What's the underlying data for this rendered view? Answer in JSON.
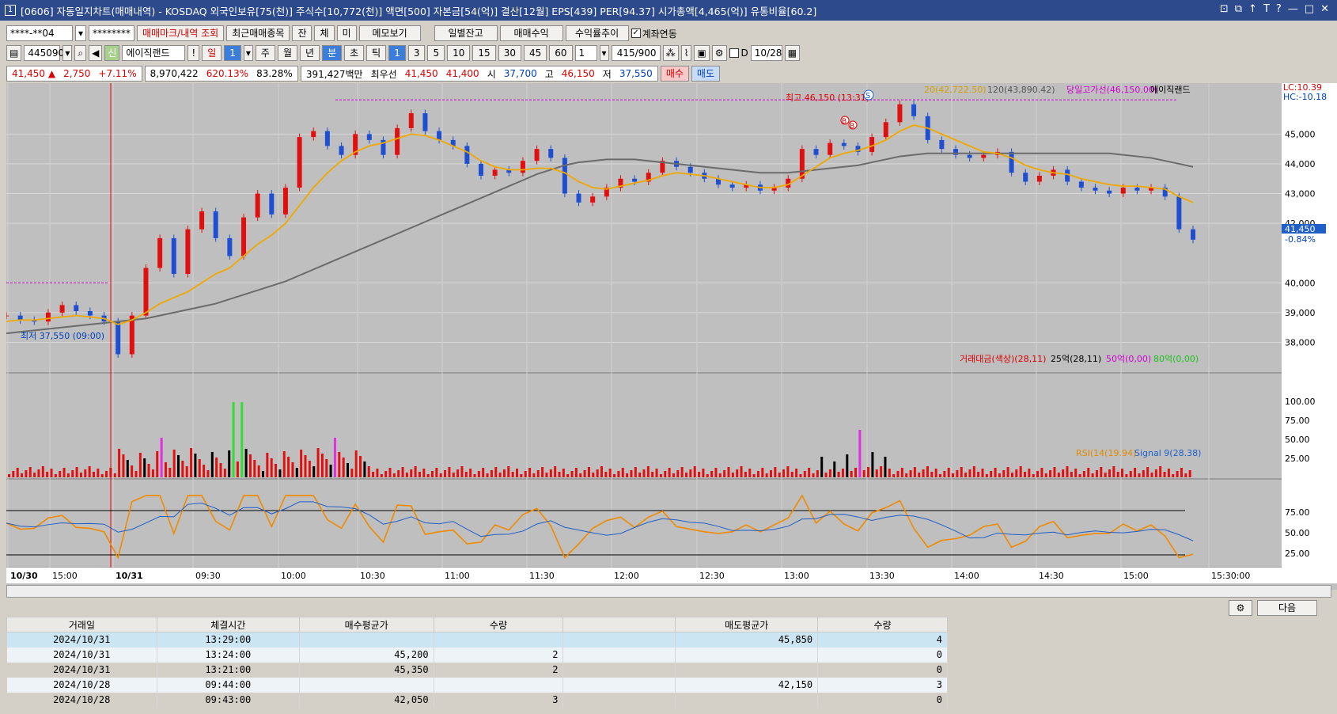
{
  "window": {
    "num": "1",
    "title": "[0606] 자동일지차트(매매내역) - KOSDAQ 외국인보유[75(천)] 주식수[10,772(천)] 액면[500] 자본금[54(억)] 결산[12월] EPS[439] PER[94.37] 시가총액[4,465(억)] 유통비율[60.2]",
    "controls": [
      "⊡",
      "⧉",
      "↑",
      "T",
      "?",
      "—",
      "□",
      "✕"
    ]
  },
  "toolbar1": {
    "account": "****-**04",
    "password": "********",
    "btn_trade_mark": "매매마크/내역 조회",
    "btn_recent": "최근매매종목",
    "btn_jan": "잔",
    "btn_che": "체",
    "btn_mi": "미",
    "btn_memo": "메모보기",
    "btn_daily": "일별잔고",
    "btn_profit": "매매수익",
    "btn_trend": "수익률추이",
    "chk_link": "계좌연동"
  },
  "toolbar2": {
    "code": "445090",
    "badge": "신",
    "name": "에이직랜드",
    "periods": [
      "일",
      "1",
      "주",
      "월",
      "년",
      "분",
      "초",
      "틱"
    ],
    "intervals": [
      "1",
      "3",
      "5",
      "10",
      "15",
      "30",
      "45",
      "60"
    ],
    "count": "1",
    "pages": "415",
    "pages_total": "/900",
    "date_label": "D",
    "date": "10/28"
  },
  "quote": {
    "price": "41,450",
    "arrow": "▲",
    "change": "2,750",
    "pct": "+7.11%",
    "volume": "8,970,422",
    "vol_pct": "620.13%",
    "ratio": "83.28%",
    "amount": "391,427백만",
    "best_label": "최우선",
    "best_ask": "41,450",
    "best_bid": "41,400",
    "open_label": "시",
    "open": "37,700",
    "high_label": "고",
    "high": "46,150",
    "low_label": "저",
    "low": "37,550",
    "buy": "매수",
    "sell": "매도"
  },
  "chart": {
    "legend_ma20": "20(42,722.50)",
    "legend_ma120": "120(43,890.42)",
    "legend_hi_line": "당일고가선(46,150.00)",
    "legend_name": "에이직랜드",
    "lc": "LC:10.39",
    "hc": "HC:-10.18",
    "annot_high": "최고 46,150 (13:31)",
    "annot_low": "최저 37,550 (09:00)",
    "price_tag": "41,450",
    "price_tag_pct": "-0.84%",
    "vol_legend_1": "거래대금(색상)(28,11)",
    "vol_legend_2": "25억(28,11)",
    "vol_legend_3": "50억(0,00)",
    "vol_legend_4": "80억(0,00)",
    "rsi_legend_1": "RSI(14(19.94)",
    "rsi_legend_2": "Signal 9(28.38)",
    "mark_s": "S",
    "mark_b": "B"
  },
  "chart_data": {
    "type": "line",
    "y_ticks": [
      38000,
      39000,
      40000,
      42000,
      43000,
      44000,
      45000
    ],
    "y_ticks_labels": [
      "38,000",
      "39,000",
      "40,000",
      "42,000",
      "43,000",
      "44,000",
      "45,000"
    ],
    "vol_ticks": [
      "25.00",
      "50.00",
      "75.00",
      "100.00"
    ],
    "rsi_ticks": [
      "25.00",
      "50.00",
      "75.00"
    ],
    "x_labels": [
      "10/30",
      "15:00",
      "10/31",
      "09:30",
      "10:00",
      "10:30",
      "11:00",
      "11:30",
      "12:00",
      "12:30",
      "13:00",
      "13:30",
      "14:00",
      "14:30",
      "15:00",
      "15:30:00"
    ],
    "close": [
      38900,
      38750,
      38700,
      39000,
      39250,
      39050,
      38900,
      38700,
      37600,
      38900,
      40500,
      41500,
      40300,
      41800,
      42400,
      41500,
      40900,
      42200,
      43000,
      42300,
      43200,
      44900,
      45100,
      44600,
      44300,
      45000,
      44800,
      44300,
      45200,
      45700,
      45100,
      44800,
      44600,
      44000,
      43600,
      43800,
      43700,
      44100,
      44500,
      44200,
      43000,
      42700,
      42900,
      43200,
      43500,
      43400,
      43700,
      44100,
      43900,
      43700,
      43500,
      43300,
      43200,
      43300,
      43100,
      43200,
      43500,
      44500,
      44300,
      44700,
      44600,
      44400,
      44900,
      45400,
      46000,
      45600,
      44800,
      44500,
      44300,
      44200,
      44300,
      44400,
      43700,
      43400,
      43600,
      43800,
      43400,
      43200,
      43100,
      43000,
      43200,
      43100,
      43200,
      42900,
      41800,
      41450
    ],
    "ma20": [
      38700,
      38750,
      38750,
      38800,
      38850,
      38900,
      38850,
      38800,
      38600,
      38750,
      39000,
      39300,
      39500,
      39700,
      40000,
      40300,
      40500,
      40900,
      41300,
      41600,
      42000,
      42600,
      43200,
      43700,
      44100,
      44400,
      44600,
      44700,
      44850,
      45000,
      44950,
      44800,
      44600,
      44400,
      44100,
      43900,
      43800,
      43800,
      43850,
      43850,
      43700,
      43400,
      43200,
      43150,
      43250,
      43350,
      43450,
      43600,
      43700,
      43650,
      43600,
      43500,
      43400,
      43300,
      43200,
      43200,
      43300,
      43600,
      43900,
      44200,
      44350,
      44450,
      44600,
      44800,
      45100,
      45300,
      45200,
      45000,
      44800,
      44600,
      44400,
      44350,
      44200,
      43950,
      43800,
      43700,
      43650,
      43500,
      43400,
      43300,
      43250,
      43250,
      43200,
      43150,
      42900,
      42700
    ],
    "ma120": [
      38300,
      38350,
      38400,
      38450,
      38500,
      38550,
      38600,
      38650,
      38700,
      38750,
      38800,
      38900,
      39000,
      39100,
      39200,
      39300,
      39450,
      39600,
      39750,
      39900,
      40050,
      40250,
      40450,
      40650,
      40850,
      41050,
      41250,
      41450,
      41650,
      41850,
      42050,
      42250,
      42450,
      42650,
      42850,
      43050,
      43250,
      43450,
      43650,
      43800,
      43950,
      44050,
      44100,
      44150,
      44150,
      44150,
      44100,
      44050,
      44000,
      43950,
      43900,
      43850,
      43800,
      43750,
      43700,
      43700,
      43700,
      43750,
      43800,
      43850,
      43900,
      43950,
      44050,
      44150,
      44250,
      44300,
      44350,
      44350,
      44350,
      44350,
      44350,
      44350,
      44350,
      44350,
      44350,
      44350,
      44350,
      44350,
      44350,
      44350,
      44300,
      44250,
      44200,
      44100,
      44000,
      43900
    ]
  },
  "table": {
    "headers": [
      "거래일",
      "체결시간",
      "매수평균가",
      "수량",
      "",
      "매도평균가",
      "수량"
    ],
    "rows": [
      [
        "2024/10/31",
        "13:29:00",
        "",
        "",
        "",
        "45,850",
        "4"
      ],
      [
        "2024/10/31",
        "13:24:00",
        "45,200",
        "2",
        "",
        "",
        "0"
      ],
      [
        "2024/10/31",
        "13:21:00",
        "45,350",
        "2",
        "",
        "",
        "0"
      ],
      [
        "2024/10/28",
        "09:44:00",
        "",
        "",
        "",
        "42,150",
        "3"
      ],
      [
        "2024/10/28",
        "09:43:00",
        "42,050",
        "3",
        "",
        "",
        "0"
      ]
    ],
    "btn_next": "다음"
  }
}
